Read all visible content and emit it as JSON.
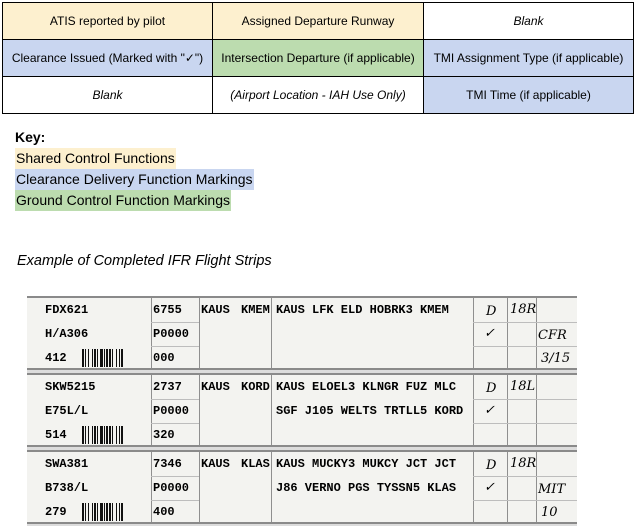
{
  "grid": {
    "rows": [
      [
        {
          "text": "ATIS reported by pilot",
          "color": "shared"
        },
        {
          "text": "Assigned Departure Runway",
          "color": "shared"
        },
        {
          "text": "Blank",
          "color": "white",
          "italic": true
        }
      ],
      [
        {
          "text": "Clearance Issued (Marked with \"✓\")",
          "color": "cd"
        },
        {
          "text": "Intersection Departure (if applicable)",
          "color": "gc"
        },
        {
          "text": "TMI Assignment Type (if applicable)",
          "color": "cd"
        }
      ],
      [
        {
          "text": "Blank",
          "color": "white",
          "italic": true
        },
        {
          "text": "(Airport Location - IAH Use Only)",
          "color": "white",
          "italic": true
        },
        {
          "text": "TMI Time (if applicable)",
          "color": "cd"
        }
      ]
    ]
  },
  "key": {
    "title": "Key:",
    "items": [
      {
        "label": "Shared Control Functions",
        "color": "#fdf0cf"
      },
      {
        "label": "Clearance Delivery Function Markings",
        "color": "#c9d6f0"
      },
      {
        "label": "Ground Control Function Markings",
        "color": "#bcdcaf"
      }
    ]
  },
  "example_caption": "Example of Completed IFR Flight Strips",
  "strips": [
    {
      "callsign": "FDX621",
      "aircraft": "H/A306",
      "cid": "412",
      "beacon": "6755",
      "proposed": "P0000",
      "altitude": "000",
      "departure": "KAUS",
      "destination": "KMEM",
      "route_line1": "KAUS LFK ELD HOBRK3 KMEM",
      "route_line2": "",
      "atis": "D",
      "runway": "18R",
      "clearance": "✓",
      "tmi_type": "CFR",
      "tmi_time": "3/15"
    },
    {
      "callsign": "SKW5215",
      "aircraft": "E75L/L",
      "cid": "514",
      "beacon": "2737",
      "proposed": "P0000",
      "altitude": "320",
      "departure": "KAUS",
      "destination": "KORD",
      "route_line1": "KAUS ELOEL3 KLNGR FUZ MLC",
      "route_line2": "SGF J105 WELTS TRTLL5 KORD",
      "atis": "D",
      "runway": "18L",
      "clearance": "✓",
      "tmi_type": "",
      "tmi_time": ""
    },
    {
      "callsign": "SWA381",
      "aircraft": "B738/L",
      "cid": "279",
      "beacon": "7346",
      "proposed": "P0000",
      "altitude": "400",
      "departure": "KAUS",
      "destination": "KLAS",
      "route_line1": "KAUS MUCKY3 MUKCY JCT JCT",
      "route_line2": "J86 VERNO PGS TYSSN5 KLAS",
      "atis": "D",
      "runway": "18R",
      "clearance": "✓",
      "tmi_type": "MIT",
      "tmi_time": "10"
    }
  ]
}
